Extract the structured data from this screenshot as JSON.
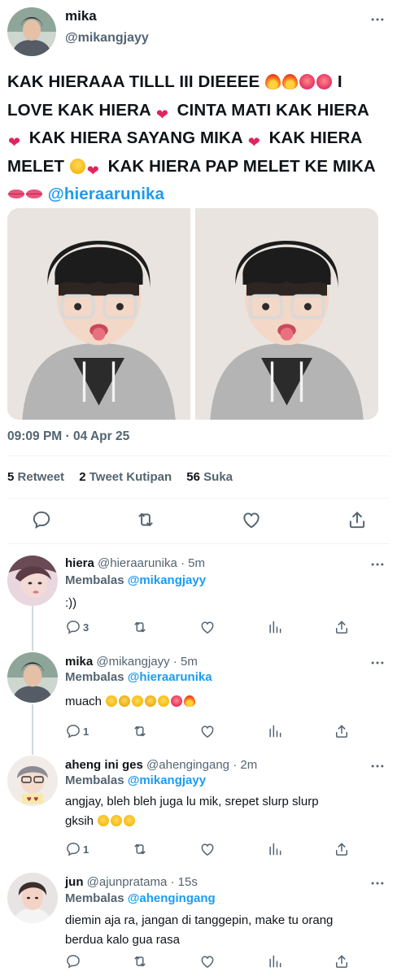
{
  "tweet": {
    "name": "mika",
    "handle": "@mikangjayy",
    "text_lines": [
      "KAK HIERAAA TILLL III DIEEEE",
      "I",
      "LOVE KAK HIERA",
      "CINTA MATI KAK HIERA",
      "KAK HIERA SAYANG MIKA",
      "KAK HIERA",
      "MELET",
      "KAK HIERA PAP MELET KE MIKA"
    ],
    "mention": "@hieraarunika",
    "timestamp": "09:09 PM · 04 Apr 25",
    "stats": {
      "retweet_count": "5",
      "retweet_label": "Retweet",
      "quote_count": "2",
      "quote_label": "Tweet Kutipan",
      "like_count": "56",
      "like_label": "Suka"
    },
    "actions": [
      "comment-icon",
      "retweet-icon",
      "heart-icon",
      "share-icon"
    ]
  },
  "replies": [
    {
      "name": "hiera",
      "handle": "@hieraarunika",
      "time": "· 5m",
      "replying_label": "Membalas",
      "replying_to": "@mikangjayy",
      "text": ":))",
      "reply_count": "3",
      "retweet_count": "",
      "like_count": ""
    },
    {
      "name": "mika",
      "handle": "@mikangjayy",
      "time": "· 5m",
      "replying_label": "Membalas",
      "replying_to": "@hieraarunika",
      "text": "muach",
      "reply_count": "1",
      "retweet_count": "",
      "like_count": ""
    },
    {
      "name": "aheng ini ges",
      "handle": "@ahengingang",
      "time": "· 2m",
      "replying_label": "Membalas",
      "replying_to": "@mikangjayy",
      "text_line1": "angjay, bleh bleh juga lu mik, srepet slurp slurp",
      "text_line2": "gksih",
      "reply_count": "1",
      "retweet_count": "",
      "like_count": ""
    },
    {
      "name": "jun",
      "handle": "@ajunpratama",
      "time": "· 15s",
      "replying_label": "Membalas",
      "replying_to": "@ahengingang",
      "text_line1": "diemin aja ra, jangan di tanggepin, make tu orang",
      "text_line2": "berdua kalo gua rasa",
      "reply_count": "",
      "retweet_count": "",
      "like_count": ""
    }
  ],
  "colors": {
    "accent": "#1d9bf0",
    "text": "#0f1419",
    "secondary": "#536471",
    "divider": "#eff3f4"
  }
}
